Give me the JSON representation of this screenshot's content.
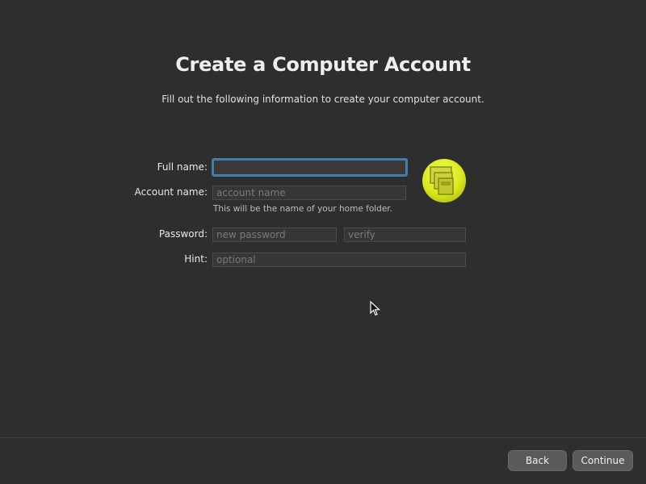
{
  "header": {
    "title": "Create a Computer Account",
    "subtitle": "Fill out the following information to create your computer account."
  },
  "form": {
    "full_name": {
      "label": "Full name:",
      "value": "",
      "placeholder": ""
    },
    "account_name": {
      "label": "Account name:",
      "value": "",
      "placeholder": "account name",
      "help": "This will be the name of your home folder."
    },
    "password": {
      "label": "Password:",
      "placeholder": "new password"
    },
    "verify": {
      "placeholder": "verify"
    },
    "hint": {
      "label": "Hint:",
      "placeholder": "optional"
    }
  },
  "avatar": {
    "icon": "photo-library-icon",
    "color": "#e3f01f"
  },
  "footer": {
    "back_label": "Back",
    "continue_label": "Continue"
  },
  "colors": {
    "background": "#2e2e2e",
    "focus_ring": "#3f7fae"
  }
}
